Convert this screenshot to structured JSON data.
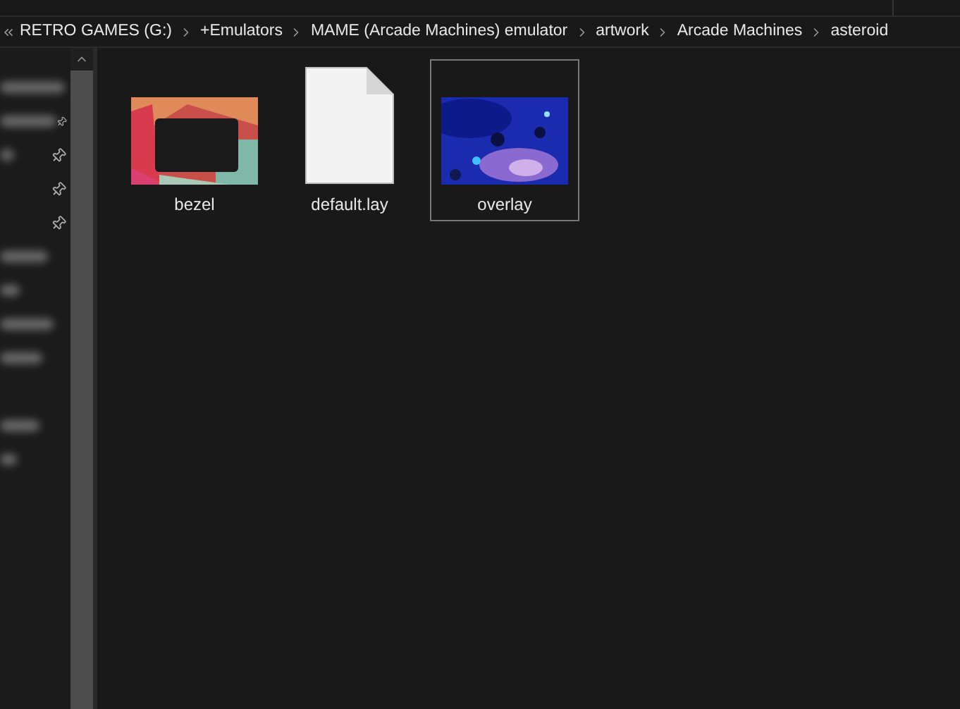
{
  "breadcrumb": [
    "RETRO GAMES (G:)",
    "+Emulators",
    "MAME (Arcade Machines) emulator",
    "artwork",
    "Arcade Machines",
    "asteroid"
  ],
  "sidebar": {
    "items": [
      {
        "pinned": false
      },
      {
        "pinned": true
      },
      {
        "pinned": true
      },
      {
        "pinned": true
      },
      {
        "pinned": true
      },
      {
        "pinned": false
      },
      {
        "pinned": false
      },
      {
        "pinned": false
      },
      {
        "pinned": false
      },
      {
        "pinned": false
      },
      {
        "pinned": false
      }
    ]
  },
  "files": [
    {
      "name": "bezel",
      "kind": "bezel-image",
      "selected": false
    },
    {
      "name": "default.lay",
      "kind": "document",
      "selected": false
    },
    {
      "name": "overlay",
      "kind": "space-image",
      "selected": true
    }
  ]
}
